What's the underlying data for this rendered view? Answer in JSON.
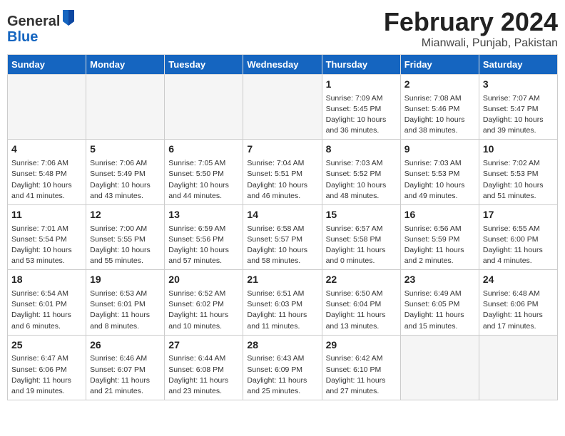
{
  "logo": {
    "general": "General",
    "blue": "Blue"
  },
  "header": {
    "title": "February 2024",
    "subtitle": "Mianwali, Punjab, Pakistan"
  },
  "weekdays": [
    "Sunday",
    "Monday",
    "Tuesday",
    "Wednesday",
    "Thursday",
    "Friday",
    "Saturday"
  ],
  "weeks": [
    [
      {
        "day": "",
        "info": ""
      },
      {
        "day": "",
        "info": ""
      },
      {
        "day": "",
        "info": ""
      },
      {
        "day": "",
        "info": ""
      },
      {
        "day": "1",
        "info": "Sunrise: 7:09 AM\nSunset: 5:45 PM\nDaylight: 10 hours\nand 36 minutes."
      },
      {
        "day": "2",
        "info": "Sunrise: 7:08 AM\nSunset: 5:46 PM\nDaylight: 10 hours\nand 38 minutes."
      },
      {
        "day": "3",
        "info": "Sunrise: 7:07 AM\nSunset: 5:47 PM\nDaylight: 10 hours\nand 39 minutes."
      }
    ],
    [
      {
        "day": "4",
        "info": "Sunrise: 7:06 AM\nSunset: 5:48 PM\nDaylight: 10 hours\nand 41 minutes."
      },
      {
        "day": "5",
        "info": "Sunrise: 7:06 AM\nSunset: 5:49 PM\nDaylight: 10 hours\nand 43 minutes."
      },
      {
        "day": "6",
        "info": "Sunrise: 7:05 AM\nSunset: 5:50 PM\nDaylight: 10 hours\nand 44 minutes."
      },
      {
        "day": "7",
        "info": "Sunrise: 7:04 AM\nSunset: 5:51 PM\nDaylight: 10 hours\nand 46 minutes."
      },
      {
        "day": "8",
        "info": "Sunrise: 7:03 AM\nSunset: 5:52 PM\nDaylight: 10 hours\nand 48 minutes."
      },
      {
        "day": "9",
        "info": "Sunrise: 7:03 AM\nSunset: 5:53 PM\nDaylight: 10 hours\nand 49 minutes."
      },
      {
        "day": "10",
        "info": "Sunrise: 7:02 AM\nSunset: 5:53 PM\nDaylight: 10 hours\nand 51 minutes."
      }
    ],
    [
      {
        "day": "11",
        "info": "Sunrise: 7:01 AM\nSunset: 5:54 PM\nDaylight: 10 hours\nand 53 minutes."
      },
      {
        "day": "12",
        "info": "Sunrise: 7:00 AM\nSunset: 5:55 PM\nDaylight: 10 hours\nand 55 minutes."
      },
      {
        "day": "13",
        "info": "Sunrise: 6:59 AM\nSunset: 5:56 PM\nDaylight: 10 hours\nand 57 minutes."
      },
      {
        "day": "14",
        "info": "Sunrise: 6:58 AM\nSunset: 5:57 PM\nDaylight: 10 hours\nand 58 minutes."
      },
      {
        "day": "15",
        "info": "Sunrise: 6:57 AM\nSunset: 5:58 PM\nDaylight: 11 hours\nand 0 minutes."
      },
      {
        "day": "16",
        "info": "Sunrise: 6:56 AM\nSunset: 5:59 PM\nDaylight: 11 hours\nand 2 minutes."
      },
      {
        "day": "17",
        "info": "Sunrise: 6:55 AM\nSunset: 6:00 PM\nDaylight: 11 hours\nand 4 minutes."
      }
    ],
    [
      {
        "day": "18",
        "info": "Sunrise: 6:54 AM\nSunset: 6:01 PM\nDaylight: 11 hours\nand 6 minutes."
      },
      {
        "day": "19",
        "info": "Sunrise: 6:53 AM\nSunset: 6:01 PM\nDaylight: 11 hours\nand 8 minutes."
      },
      {
        "day": "20",
        "info": "Sunrise: 6:52 AM\nSunset: 6:02 PM\nDaylight: 11 hours\nand 10 minutes."
      },
      {
        "day": "21",
        "info": "Sunrise: 6:51 AM\nSunset: 6:03 PM\nDaylight: 11 hours\nand 11 minutes."
      },
      {
        "day": "22",
        "info": "Sunrise: 6:50 AM\nSunset: 6:04 PM\nDaylight: 11 hours\nand 13 minutes."
      },
      {
        "day": "23",
        "info": "Sunrise: 6:49 AM\nSunset: 6:05 PM\nDaylight: 11 hours\nand 15 minutes."
      },
      {
        "day": "24",
        "info": "Sunrise: 6:48 AM\nSunset: 6:06 PM\nDaylight: 11 hours\nand 17 minutes."
      }
    ],
    [
      {
        "day": "25",
        "info": "Sunrise: 6:47 AM\nSunset: 6:06 PM\nDaylight: 11 hours\nand 19 minutes."
      },
      {
        "day": "26",
        "info": "Sunrise: 6:46 AM\nSunset: 6:07 PM\nDaylight: 11 hours\nand 21 minutes."
      },
      {
        "day": "27",
        "info": "Sunrise: 6:44 AM\nSunset: 6:08 PM\nDaylight: 11 hours\nand 23 minutes."
      },
      {
        "day": "28",
        "info": "Sunrise: 6:43 AM\nSunset: 6:09 PM\nDaylight: 11 hours\nand 25 minutes."
      },
      {
        "day": "29",
        "info": "Sunrise: 6:42 AM\nSunset: 6:10 PM\nDaylight: 11 hours\nand 27 minutes."
      },
      {
        "day": "",
        "info": ""
      },
      {
        "day": "",
        "info": ""
      }
    ]
  ]
}
